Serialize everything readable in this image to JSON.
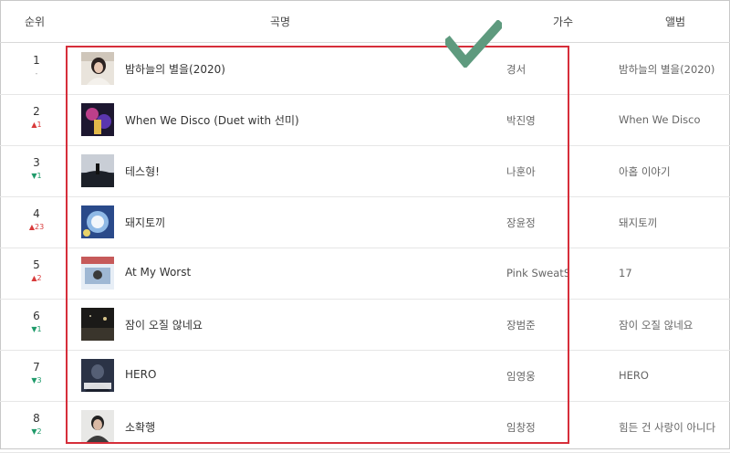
{
  "header": {
    "rank": "순위",
    "title": "곡명",
    "artist": "가수",
    "album": "앨범"
  },
  "colors": {
    "highlight": "#d62e3a",
    "check": "#5e9a7e",
    "rank_up": "#d83a3a",
    "rank_down": "#1f9a6a"
  },
  "rows": [
    {
      "rank": "1",
      "change": "-",
      "direction": "same",
      "title": "밤하늘의 별을(2020)",
      "artist": "경서",
      "album": "밤하늘의 별을(2020)"
    },
    {
      "rank": "2",
      "change": "1",
      "direction": "up",
      "title": "When We Disco (Duet with 선미)",
      "artist": "박진영",
      "album": "When We Disco"
    },
    {
      "rank": "3",
      "change": "1",
      "direction": "down",
      "title": "테스형!",
      "artist": "나훈아",
      "album": "아홉 이야기"
    },
    {
      "rank": "4",
      "change": "23",
      "direction": "up",
      "title": "돼지토끼",
      "artist": "장윤정",
      "album": "돼지토끼"
    },
    {
      "rank": "5",
      "change": "2",
      "direction": "up",
      "title": "At My Worst",
      "artist": "Pink SweatS",
      "album": "17"
    },
    {
      "rank": "6",
      "change": "1",
      "direction": "down",
      "title": "잠이 오질 않네요",
      "artist": "장범준",
      "album": "잠이 오질 않네요"
    },
    {
      "rank": "7",
      "change": "3",
      "direction": "down",
      "title": "HERO",
      "artist": "임영웅",
      "album": "HERO"
    },
    {
      "rank": "8",
      "change": "2",
      "direction": "down",
      "title": "소확행",
      "artist": "임창정",
      "album": "힘든 건 사랑이 아니다"
    }
  ]
}
